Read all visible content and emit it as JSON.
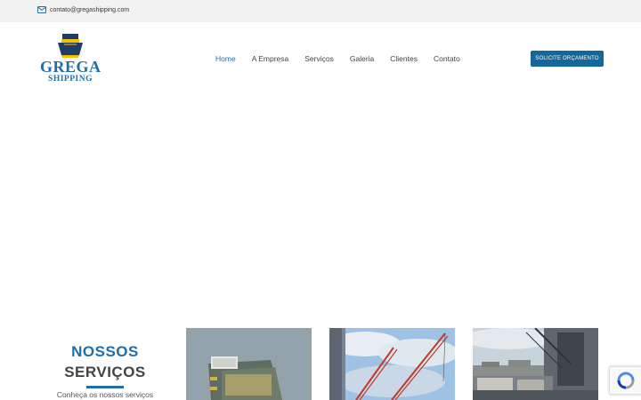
{
  "topbar": {
    "email": "contato@gregashipping.com",
    "icon": "envelope-icon"
  },
  "logo": {
    "brand": "GREGA",
    "sub": "SHIPPING"
  },
  "nav": {
    "items": [
      {
        "label": "Home",
        "active": true
      },
      {
        "label": "A Empresa",
        "active": false
      },
      {
        "label": "Serviços",
        "active": false
      },
      {
        "label": "Galeria",
        "active": false
      },
      {
        "label": "Clientes",
        "active": false
      },
      {
        "label": "Contato",
        "active": false
      }
    ]
  },
  "cta": {
    "label": "SOLICITE ORÇAMENTO"
  },
  "services": {
    "title_line1": "NOSSOS",
    "title_line2": "SERVIÇOS",
    "subtitle": "Conheça os nossos serviços"
  },
  "colors": {
    "brand_blue": "#1e6fa8",
    "cta_bg": "#14679b",
    "topbar_bg": "#f2f2f2"
  },
  "recaptcha": {
    "icon": "recaptcha-icon"
  }
}
